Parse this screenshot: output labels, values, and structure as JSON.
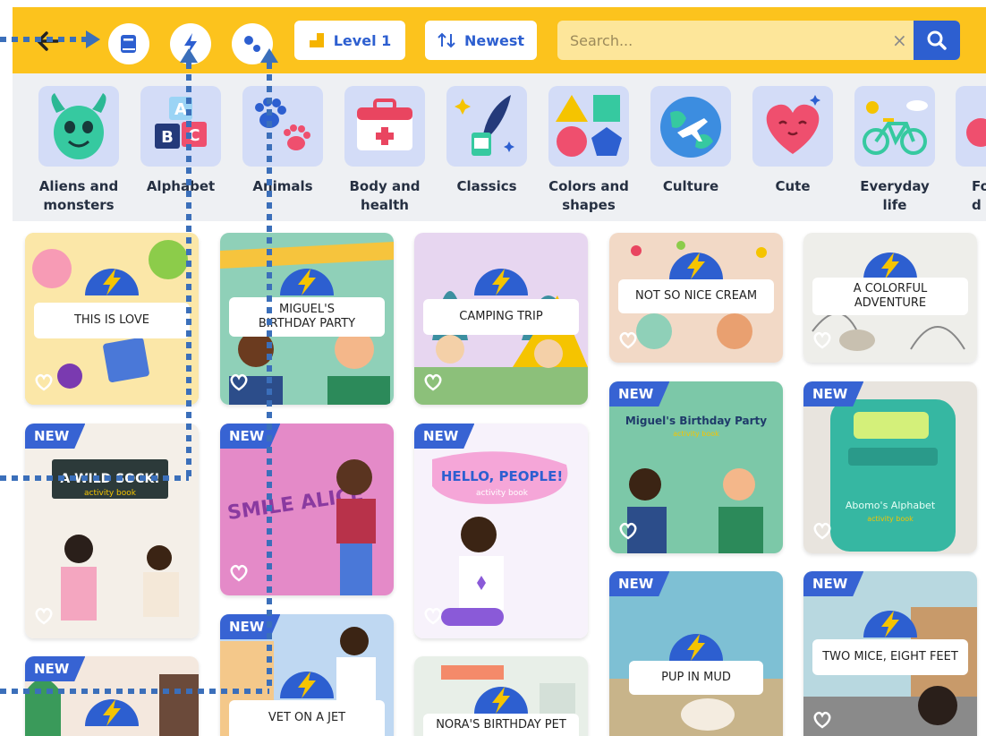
{
  "toolbar": {
    "level_label": "Level 1",
    "sort_label": "Newest",
    "search_placeholder": "Search...",
    "clear_glyph": "×"
  },
  "categories": [
    {
      "label_1": "Aliens and",
      "label_2": "monsters"
    },
    {
      "label_1": "Alphabet",
      "label_2": ""
    },
    {
      "label_1": "Animals",
      "label_2": ""
    },
    {
      "label_1": "Body and",
      "label_2": "health"
    },
    {
      "label_1": "Classics",
      "label_2": ""
    },
    {
      "label_1": "Colors and",
      "label_2": "shapes"
    },
    {
      "label_1": "Culture",
      "label_2": ""
    },
    {
      "label_1": "Cute",
      "label_2": ""
    },
    {
      "label_1": "Everyday",
      "label_2": "life"
    },
    {
      "label_1": "Fo",
      "label_2": "d"
    }
  ],
  "books": [
    {
      "title": "THIS IS LOVE",
      "new": ""
    },
    {
      "title": "MIGUEL'S BIRTHDAY PARTY",
      "new": ""
    },
    {
      "title": "CAMPING TRIP",
      "new": ""
    },
    {
      "title": "NOT SO NICE CREAM",
      "new": ""
    },
    {
      "title": "A COLORFUL ADVENTURE",
      "new": ""
    },
    {
      "title": "A WILD SOCK!",
      "subtitle": "activity book",
      "new": "NEW"
    },
    {
      "title": "BIG SMILE ALICE",
      "new": "NEW"
    },
    {
      "title": "HELLO, PEOPLE!",
      "subtitle": "activity book",
      "new": "NEW"
    },
    {
      "title": "Miguel's Birthday Party",
      "subtitle": "activity book",
      "new": "NEW"
    },
    {
      "title": "Abomo's Alphabet",
      "subtitle": "activity book",
      "new": "NEW"
    },
    {
      "title": "VET ON A JET",
      "new": "NEW"
    },
    {
      "title": "PUP IN MUD",
      "new": "NEW"
    },
    {
      "title": "TWO MICE, EIGHT FEET",
      "new": "NEW"
    },
    {
      "title": "",
      "new": "NEW"
    },
    {
      "title": "NORA'S BIRTHDAY PET",
      "new": ""
    }
  ],
  "colors": {
    "topbar": "#fcc31d",
    "accent": "#2d5fd0",
    "new_tag": "#3763d3",
    "tile": "#d3dcf7"
  }
}
